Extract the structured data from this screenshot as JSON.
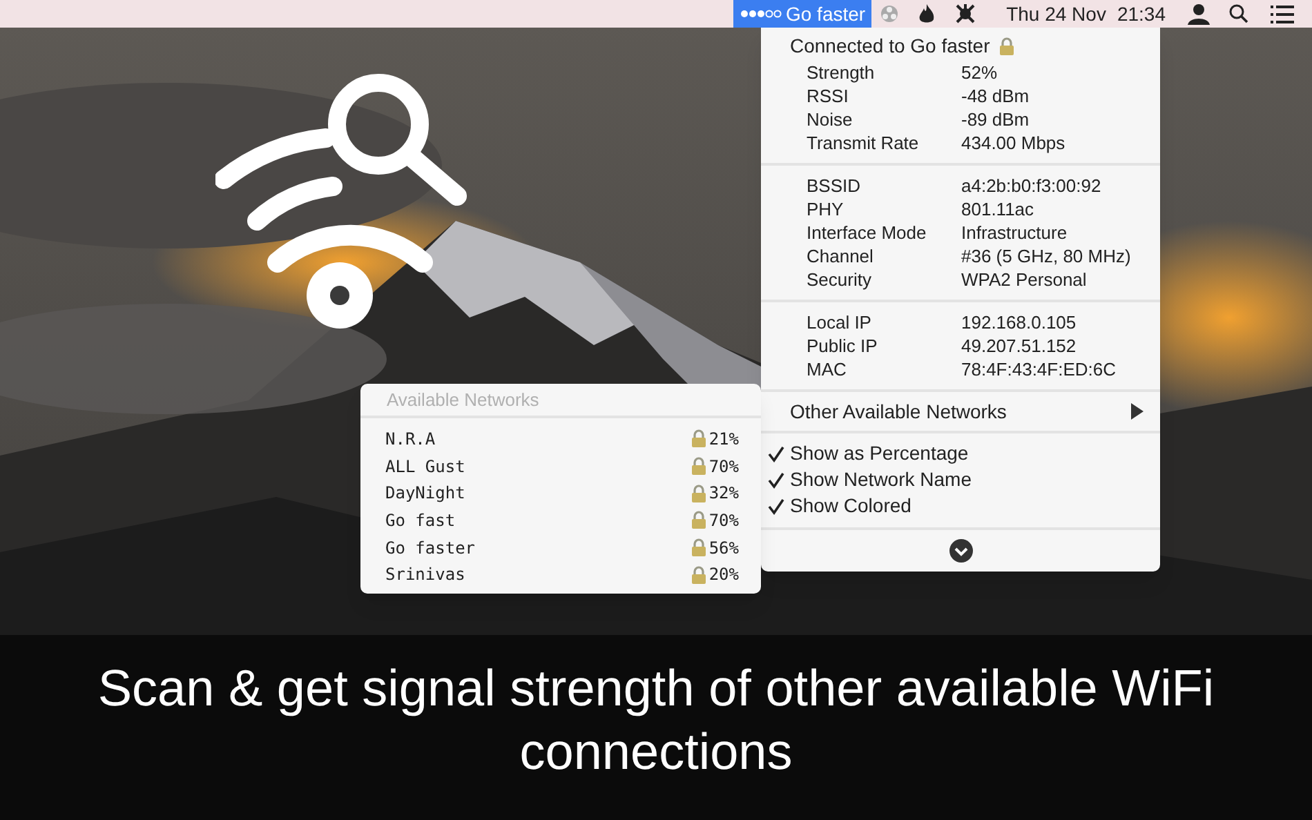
{
  "menu_bar": {
    "status_item": {
      "label": "Go faster",
      "selected": true
    },
    "date": "Thu 24 Nov",
    "time": "21:34"
  },
  "wifi_menu": {
    "header": "Connected to Go faster",
    "sections": [
      [
        {
          "label": "Strength",
          "value": "52%"
        },
        {
          "label": "RSSI",
          "value": "-48 dBm"
        },
        {
          "label": "Noise",
          "value": "-89 dBm"
        },
        {
          "label": "Transmit Rate",
          "value": "434.00 Mbps"
        }
      ],
      [
        {
          "label": "BSSID",
          "value": "a4:2b:b0:f3:00:92"
        },
        {
          "label": "PHY",
          "value": "801.11ac"
        },
        {
          "label": "Interface Mode",
          "value": "Infrastructure"
        },
        {
          "label": "Channel",
          "value": "#36 (5 GHz, 80 MHz)"
        },
        {
          "label": "Security",
          "value": "WPA2 Personal"
        }
      ],
      [
        {
          "label": "Local IP",
          "value": "192.168.0.105"
        },
        {
          "label": "Public IP",
          "value": "49.207.51.152"
        },
        {
          "label": "MAC",
          "value": "78:4F:43:4F:ED:6C"
        }
      ]
    ],
    "submenu_item": {
      "label": "Other Available Networks",
      "expanded": true
    },
    "options": [
      {
        "label": "Show as Percentage",
        "checked": true
      },
      {
        "label": "Show Network Name",
        "checked": true
      },
      {
        "label": "Show Colored",
        "checked": true
      }
    ]
  },
  "available_networks": {
    "title": "Available Networks",
    "networks": [
      {
        "name": "N.R.A",
        "strength": "21%"
      },
      {
        "name": "ALL Gust",
        "strength": "70%"
      },
      {
        "name": "DayNight",
        "strength": "32%"
      },
      {
        "name": "Go fast",
        "strength": "70%"
      },
      {
        "name": "Go faster",
        "strength": "56%"
      },
      {
        "name": "Srinivas",
        "strength": "20%"
      }
    ]
  },
  "caption": "Scan & get signal strength of other available WiFi connections"
}
